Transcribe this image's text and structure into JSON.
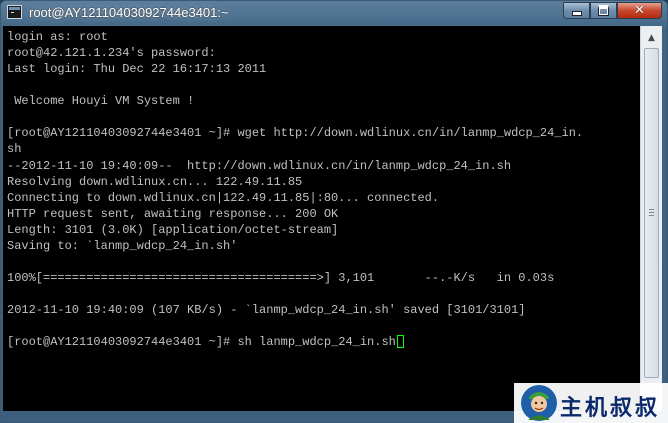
{
  "window": {
    "title": "root@AY12110403092744e3401:~",
    "icon": "terminal-app-icon",
    "controls": {
      "minimize": "minimize-icon",
      "maximize": "maximize-icon",
      "close": "close-icon"
    }
  },
  "terminal": {
    "lines": [
      "login as: root",
      "root@42.121.1.234's password:",
      "Last login: Thu Dec 22 16:17:13 2011",
      "",
      " Welcome Houyi VM System !",
      "",
      "[root@AY12110403092744e3401 ~]# wget http://down.wdlinux.cn/in/lanmp_wdcp_24_in.",
      "sh",
      "--2012-11-10 19:40:09--  http://down.wdlinux.cn/in/lanmp_wdcp_24_in.sh",
      "Resolving down.wdlinux.cn... 122.49.11.85",
      "Connecting to down.wdlinux.cn|122.49.11.85|:80... connected.",
      "HTTP request sent, awaiting response... 200 OK",
      "Length: 3101 (3.0K) [application/octet-stream]",
      "Saving to: `lanmp_wdcp_24_in.sh'",
      "",
      "100%[======================================>] 3,101       --.-K/s   in 0.03s",
      "",
      "2012-11-10 19:40:09 (107 KB/s) - `lanmp_wdcp_24_in.sh' saved [3101/3101]",
      "",
      "[root@AY12110403092744e3401 ~]# sh lanmp_wdcp_24_in.sh"
    ],
    "foreground_color": "#c0c0c0",
    "background_color": "#000000",
    "cursor_color": "#00ff00"
  },
  "scrollbar": {
    "up": "scroll-up-arrow-icon",
    "down": "scroll-down-arrow-icon"
  },
  "watermark": {
    "text": "主机叔叔",
    "mascot": "mascot-logo-icon",
    "color": "#0a2a6b"
  }
}
